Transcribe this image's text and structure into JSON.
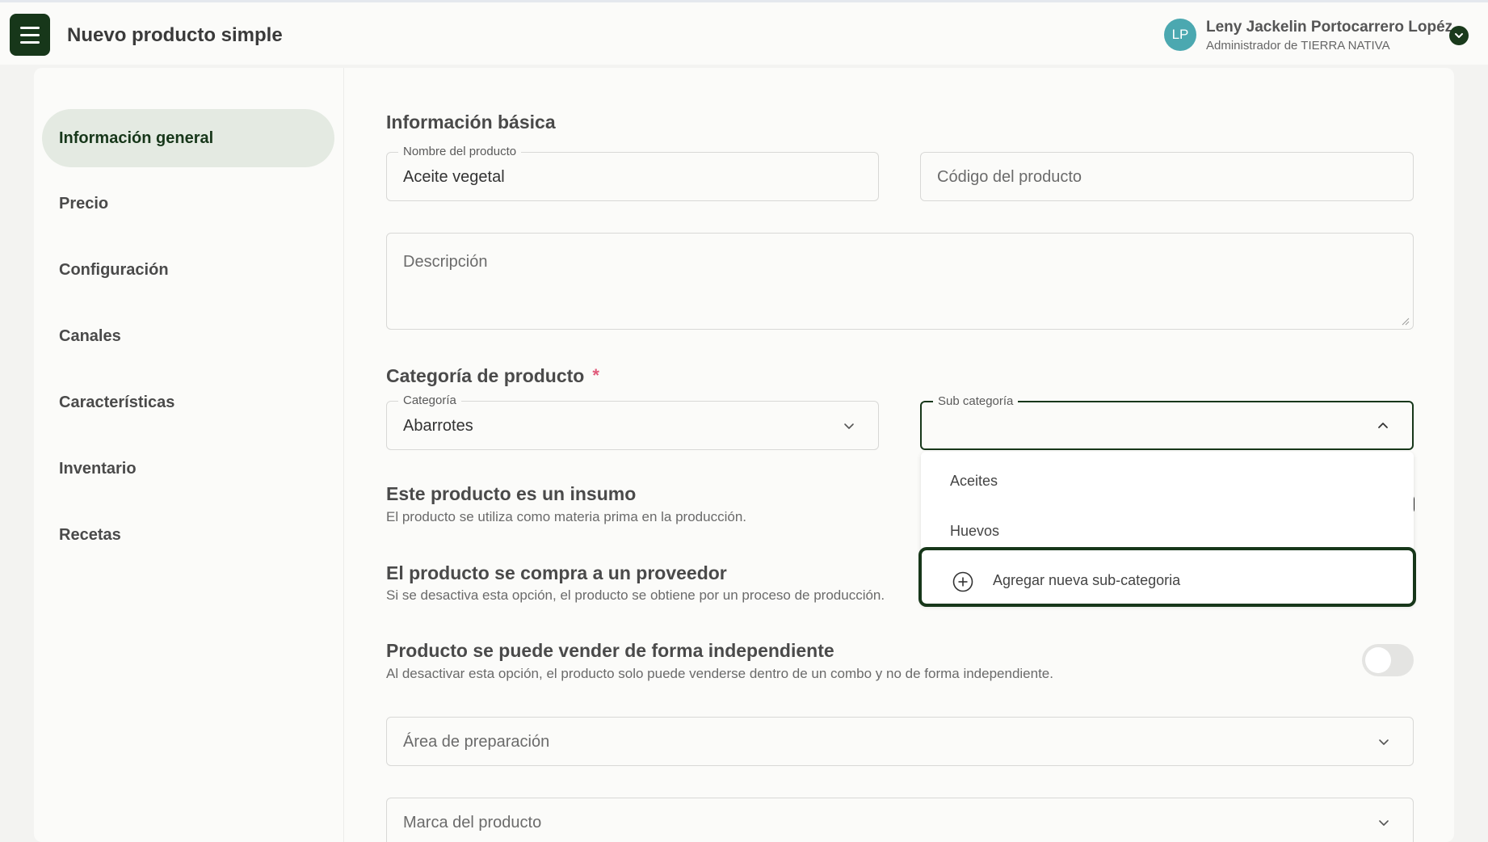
{
  "header": {
    "title": "Nuevo producto simple",
    "user": {
      "initials": "LP",
      "name": "Leny Jackelin Portocarrero Lopéz",
      "role": "Administrador de TIERRA NATIVA"
    }
  },
  "sidebar": {
    "items": [
      {
        "label": "Información general",
        "active": true
      },
      {
        "label": "Precio"
      },
      {
        "label": "Configuración"
      },
      {
        "label": "Canales"
      },
      {
        "label": "Características"
      },
      {
        "label": "Inventario"
      },
      {
        "label": "Recetas"
      }
    ]
  },
  "basic_info": {
    "title": "Información básica",
    "name_field": {
      "label": "Nombre del producto",
      "value": "Aceite vegetal"
    },
    "code_field": {
      "placeholder": "Código del producto"
    },
    "description_field": {
      "placeholder": "Descripción"
    }
  },
  "category": {
    "title": "Categoría de producto",
    "required_mark": "*",
    "category_field": {
      "label": "Categoría",
      "value": "Abarrotes"
    },
    "subcategory_field": {
      "label": "Sub categoría",
      "value": ""
    },
    "dropdown": {
      "options": [
        "Aceites",
        "Huevos"
      ],
      "add_option": "Agregar nueva sub-categoria"
    }
  },
  "settings": {
    "insumo": {
      "title": "Este producto es un insumo",
      "description": "El producto se utiliza como materia prima en la producción."
    },
    "proveedor": {
      "title": "El producto se compra a un proveedor",
      "description": "Si se desactiva esta opción, el producto se obtiene por un proceso de producción."
    },
    "independiente": {
      "title": "Producto se puede vender de forma independiente",
      "description": "Al desactivar esta opción, el producto solo puede venderse dentro de un combo y no de forma independiente.",
      "enabled": false
    }
  },
  "extra_fields": {
    "area": {
      "placeholder": "Área de preparación"
    },
    "marca": {
      "placeholder": "Marca del producto"
    }
  },
  "colors": {
    "brand_dark": "#17371a",
    "active_nav_bg": "#e4eae2",
    "avatar": "#4ba8b0",
    "required": "#e05a7a"
  }
}
